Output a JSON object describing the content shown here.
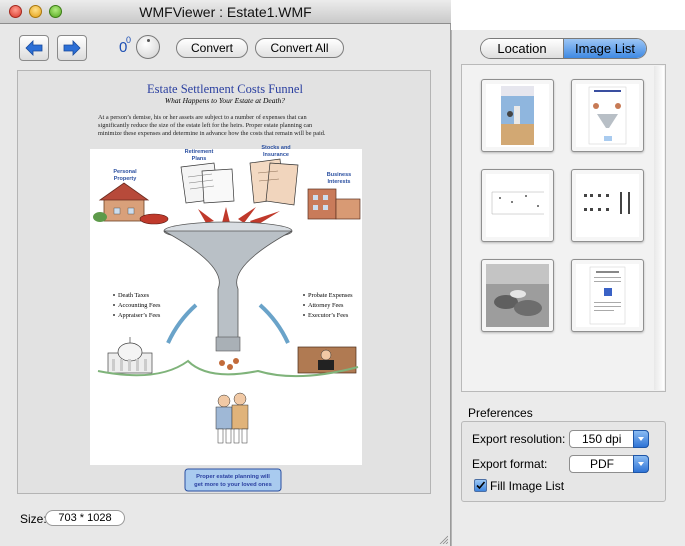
{
  "window": {
    "title": "WMFViewer : Estate1.WMF",
    "rotation_value": "0",
    "rotation_degree": "0"
  },
  "toolbar": {
    "back_icon": "arrow-left-icon",
    "forward_icon": "arrow-right-icon",
    "convert_label": "Convert",
    "convert_all_label": "Convert All"
  },
  "document": {
    "heading": "Estate Settlement Costs Funnel",
    "subheading": "What Happens to Your Estate at Death?",
    "paragraph_lines": [
      "At a person’s demise, his or her assets are subject to a number of expenses that can",
      "significantly reduce the size of the estate left for the heirs.  Proper estate planning can",
      "minimize these expenses and determine in advance how the costs that remain will be paid."
    ],
    "labels": {
      "personal_property_1": "Personal",
      "personal_property_2": "Property",
      "retirement_1": "Retirement",
      "retirement_2": "Plans",
      "stocks_1": "Stocks and",
      "stocks_2": "Insurance",
      "business_1": "Business",
      "business_2": "Interests"
    },
    "left_costs": [
      "Death Taxes",
      "Accounting Fees",
      "Appraiser’s Fees"
    ],
    "right_costs": [
      "Probate Expenses",
      "Attorney Fees",
      "Executor’s Fees"
    ],
    "footer_1": "Proper estate planning will",
    "footer_2": "get more to your loved ones"
  },
  "status": {
    "size_label": "Size:",
    "size_value": "703 * 1028"
  },
  "drawer": {
    "tabs": [
      {
        "label": "Location",
        "active": false
      },
      {
        "label": "Image List",
        "active": true
      }
    ],
    "preferences_title": "Preferences",
    "export_resolution_label": "Export resolution:",
    "export_resolution_value": "150 dpi",
    "export_format_label": "Export format:",
    "export_format_value": "PDF",
    "fill_image_list_label": "Fill Image List",
    "fill_image_list_checked": true
  },
  "colors": {
    "accent_blue": "#3f89e3",
    "heading_blue": "#2a3fa0"
  }
}
